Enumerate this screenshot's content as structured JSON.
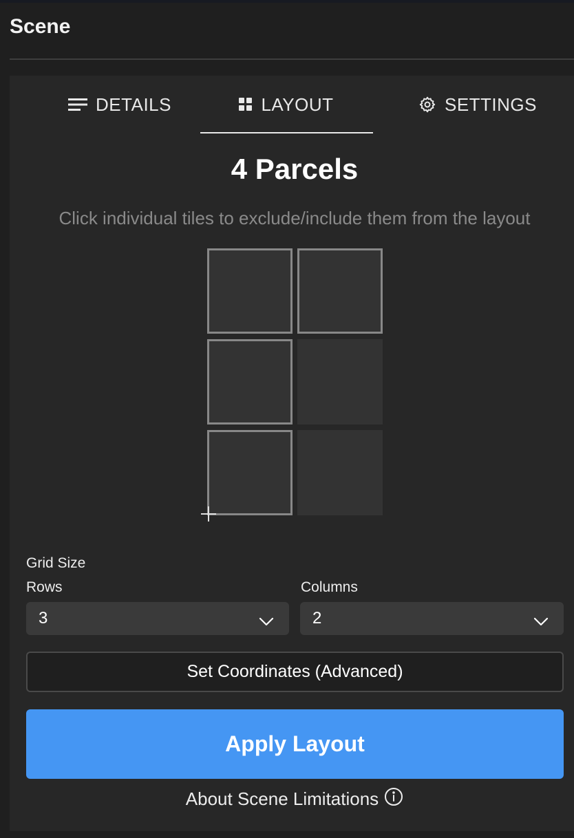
{
  "header": {
    "title": "Scene"
  },
  "tabs": [
    {
      "label": "DETAILS",
      "icon": "lines-icon"
    },
    {
      "label": "LAYOUT",
      "icon": "grid-icon",
      "active": true
    },
    {
      "label": "SETTINGS",
      "icon": "gear-icon"
    }
  ],
  "layout": {
    "title": "4 Parcels",
    "hint": "Click individual tiles to exclude/include them from the layout",
    "tiles": [
      [
        true,
        true
      ],
      [
        true,
        false
      ],
      [
        true,
        false
      ]
    ],
    "grid_size_label": "Grid Size",
    "rows_label": "Rows",
    "rows_value": "3",
    "columns_label": "Columns",
    "columns_value": "2",
    "set_coordinates_label": "Set Coordinates (Advanced)",
    "apply_label": "Apply Layout",
    "about_label": "About Scene Limitations"
  },
  "colors": {
    "background": "#1f1f1f",
    "panel": "#272727",
    "tile": "#333333",
    "tile_border": "#888888",
    "primary": "#4596f3",
    "hint_text": "#8a8a8a"
  }
}
